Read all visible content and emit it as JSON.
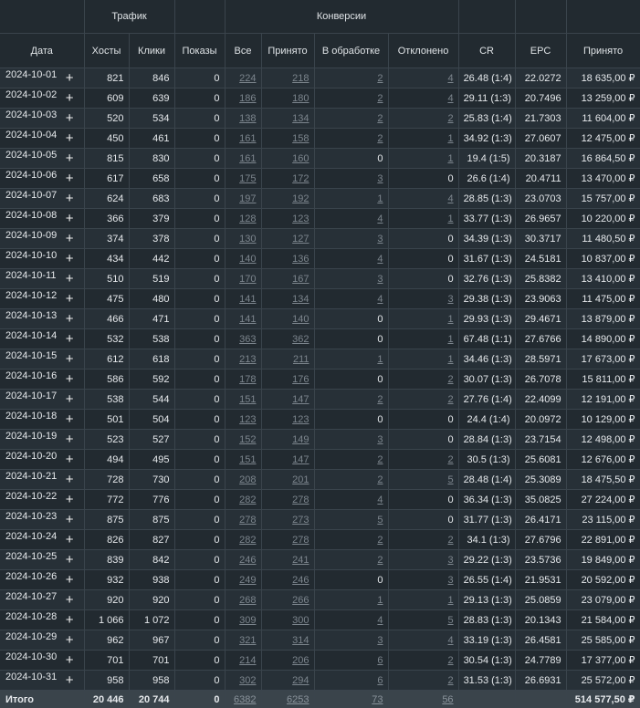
{
  "headers": {
    "groups": [
      "Трафик",
      "Конверсии"
    ],
    "columns": [
      "Дата",
      "Хосты",
      "Клики",
      "Показы",
      "Все",
      "Принято",
      "В обработке",
      "Отклонено",
      "CR",
      "EPC",
      "Принято"
    ]
  },
  "rows": [
    [
      "2024-10-01",
      "821",
      "846",
      "0",
      "224",
      "218",
      "2",
      "4",
      "26.48 (1:4)",
      "22.0272",
      "18 635,00 ₽"
    ],
    [
      "2024-10-02",
      "609",
      "639",
      "0",
      "186",
      "180",
      "2",
      "4",
      "29.11 (1:3)",
      "20.7496",
      "13 259,00 ₽"
    ],
    [
      "2024-10-03",
      "520",
      "534",
      "0",
      "138",
      "134",
      "2",
      "2",
      "25.83 (1:4)",
      "21.7303",
      "11 604,00 ₽"
    ],
    [
      "2024-10-04",
      "450",
      "461",
      "0",
      "161",
      "158",
      "2",
      "1",
      "34.92 (1:3)",
      "27.0607",
      "12 475,00 ₽"
    ],
    [
      "2024-10-05",
      "815",
      "830",
      "0",
      "161",
      "160",
      "0",
      "1",
      "19.4 (1:5)",
      "20.3187",
      "16 864,50 ₽"
    ],
    [
      "2024-10-06",
      "617",
      "658",
      "0",
      "175",
      "172",
      "3",
      "0",
      "26.6 (1:4)",
      "20.4711",
      "13 470,00 ₽"
    ],
    [
      "2024-10-07",
      "624",
      "683",
      "0",
      "197",
      "192",
      "1",
      "4",
      "28.85 (1:3)",
      "23.0703",
      "15 757,00 ₽"
    ],
    [
      "2024-10-08",
      "366",
      "379",
      "0",
      "128",
      "123",
      "4",
      "1",
      "33.77 (1:3)",
      "26.9657",
      "10 220,00 ₽"
    ],
    [
      "2024-10-09",
      "374",
      "378",
      "0",
      "130",
      "127",
      "3",
      "0",
      "34.39 (1:3)",
      "30.3717",
      "11 480,50 ₽"
    ],
    [
      "2024-10-10",
      "434",
      "442",
      "0",
      "140",
      "136",
      "4",
      "0",
      "31.67 (1:3)",
      "24.5181",
      "10 837,00 ₽"
    ],
    [
      "2024-10-11",
      "510",
      "519",
      "0",
      "170",
      "167",
      "3",
      "0",
      "32.76 (1:3)",
      "25.8382",
      "13 410,00 ₽"
    ],
    [
      "2024-10-12",
      "475",
      "480",
      "0",
      "141",
      "134",
      "4",
      "3",
      "29.38 (1:3)",
      "23.9063",
      "11 475,00 ₽"
    ],
    [
      "2024-10-13",
      "466",
      "471",
      "0",
      "141",
      "140",
      "0",
      "1",
      "29.93 (1:3)",
      "29.4671",
      "13 879,00 ₽"
    ],
    [
      "2024-10-14",
      "532",
      "538",
      "0",
      "363",
      "362",
      "0",
      "1",
      "67.48 (1:1)",
      "27.6766",
      "14 890,00 ₽"
    ],
    [
      "2024-10-15",
      "612",
      "618",
      "0",
      "213",
      "211",
      "1",
      "1",
      "34.46 (1:3)",
      "28.5971",
      "17 673,00 ₽"
    ],
    [
      "2024-10-16",
      "586",
      "592",
      "0",
      "178",
      "176",
      "0",
      "2",
      "30.07 (1:3)",
      "26.7078",
      "15 811,00 ₽"
    ],
    [
      "2024-10-17",
      "538",
      "544",
      "0",
      "151",
      "147",
      "2",
      "2",
      "27.76 (1:4)",
      "22.4099",
      "12 191,00 ₽"
    ],
    [
      "2024-10-18",
      "501",
      "504",
      "0",
      "123",
      "123",
      "0",
      "0",
      "24.4 (1:4)",
      "20.0972",
      "10 129,00 ₽"
    ],
    [
      "2024-10-19",
      "523",
      "527",
      "0",
      "152",
      "149",
      "3",
      "0",
      "28.84 (1:3)",
      "23.7154",
      "12 498,00 ₽"
    ],
    [
      "2024-10-20",
      "494",
      "495",
      "0",
      "151",
      "147",
      "2",
      "2",
      "30.5 (1:3)",
      "25.6081",
      "12 676,00 ₽"
    ],
    [
      "2024-10-21",
      "728",
      "730",
      "0",
      "208",
      "201",
      "2",
      "5",
      "28.48 (1:4)",
      "25.3089",
      "18 475,50 ₽"
    ],
    [
      "2024-10-22",
      "772",
      "776",
      "0",
      "282",
      "278",
      "4",
      "0",
      "36.34 (1:3)",
      "35.0825",
      "27 224,00 ₽"
    ],
    [
      "2024-10-23",
      "875",
      "875",
      "0",
      "278",
      "273",
      "5",
      "0",
      "31.77 (1:3)",
      "26.4171",
      "23 115,00 ₽"
    ],
    [
      "2024-10-24",
      "826",
      "827",
      "0",
      "282",
      "278",
      "2",
      "2",
      "34.1 (1:3)",
      "27.6796",
      "22 891,00 ₽"
    ],
    [
      "2024-10-25",
      "839",
      "842",
      "0",
      "246",
      "241",
      "2",
      "3",
      "29.22 (1:3)",
      "23.5736",
      "19 849,00 ₽"
    ],
    [
      "2024-10-26",
      "932",
      "938",
      "0",
      "249",
      "246",
      "0",
      "3",
      "26.55 (1:4)",
      "21.9531",
      "20 592,00 ₽"
    ],
    [
      "2024-10-27",
      "920",
      "920",
      "0",
      "268",
      "266",
      "1",
      "1",
      "29.13 (1:3)",
      "25.0859",
      "23 079,00 ₽"
    ],
    [
      "2024-10-28",
      "1 066",
      "1 072",
      "0",
      "309",
      "300",
      "4",
      "5",
      "28.83 (1:3)",
      "20.1343",
      "21 584,00 ₽"
    ],
    [
      "2024-10-29",
      "962",
      "967",
      "0",
      "321",
      "314",
      "3",
      "4",
      "33.19 (1:3)",
      "26.4581",
      "25 585,00 ₽"
    ],
    [
      "2024-10-30",
      "701",
      "701",
      "0",
      "214",
      "206",
      "6",
      "2",
      "30.54 (1:3)",
      "24.7789",
      "17 377,00 ₽"
    ],
    [
      "2024-10-31",
      "958",
      "958",
      "0",
      "302",
      "294",
      "6",
      "2",
      "31.53 (1:3)",
      "26.6931",
      "25 572,00 ₽"
    ]
  ],
  "totals": {
    "label": "Итого",
    "values": [
      "20 446",
      "20 744",
      "0",
      "6382",
      "6253",
      "73",
      "56",
      "",
      "",
      "514 577,50 ₽"
    ]
  },
  "icons": {
    "expand": "plus-icon"
  }
}
